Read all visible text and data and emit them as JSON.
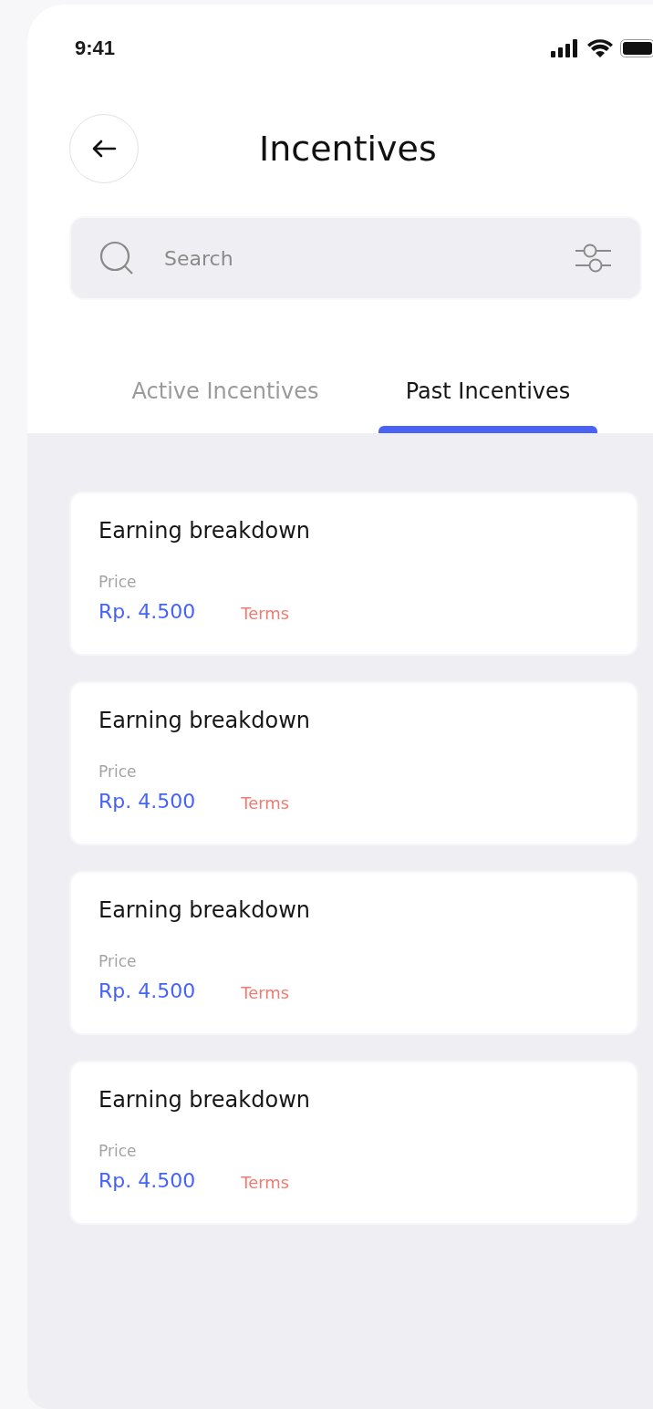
{
  "status_bar": {
    "time": "9:41"
  },
  "header": {
    "title": "Incentives"
  },
  "search": {
    "placeholder": "Search"
  },
  "tabs": [
    {
      "label": "Active Incentives",
      "selected": false
    },
    {
      "label": "Past Incentives",
      "selected": true
    }
  ],
  "cards": [
    {
      "title": "Earning breakdown",
      "price_label": "Price",
      "price": "Rp. 4.500",
      "link": "Terms"
    },
    {
      "title": "Earning breakdown",
      "price_label": "Price",
      "price": "Rp. 4.500",
      "link": "Terms"
    },
    {
      "title": "Earning breakdown",
      "price_label": "Price",
      "price": "Rp. 4.500",
      "link": "Terms"
    },
    {
      "title": "Earning breakdown",
      "price_label": "Price",
      "price": "Rp. 4.500",
      "link": "Terms"
    }
  ]
}
